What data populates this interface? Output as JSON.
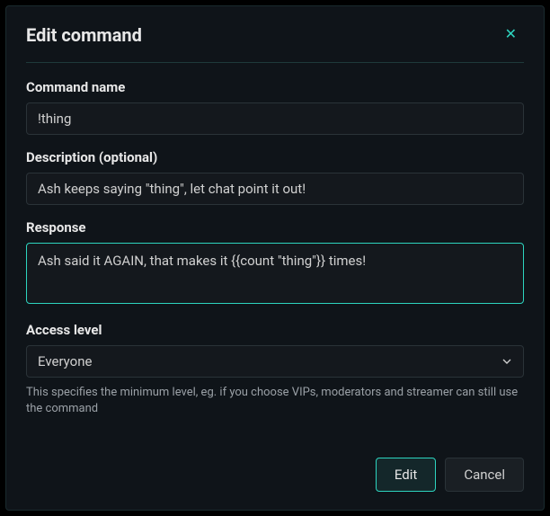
{
  "modal": {
    "title": "Edit command",
    "fields": {
      "commandName": {
        "label": "Command name",
        "value": "!thing"
      },
      "description": {
        "label": "Description (optional)",
        "value": "Ash keeps saying \"thing\", let chat point it out!"
      },
      "response": {
        "label": "Response",
        "value": "Ash said it AGAIN, that makes it {{count \"thing\"}} times!"
      },
      "accessLevel": {
        "label": "Access level",
        "value": "Everyone",
        "help": "This specifies the minimum level, eg. if you choose VIPs, moderators and streamer can still use the command"
      }
    },
    "buttons": {
      "primary": "Edit",
      "secondary": "Cancel"
    }
  }
}
